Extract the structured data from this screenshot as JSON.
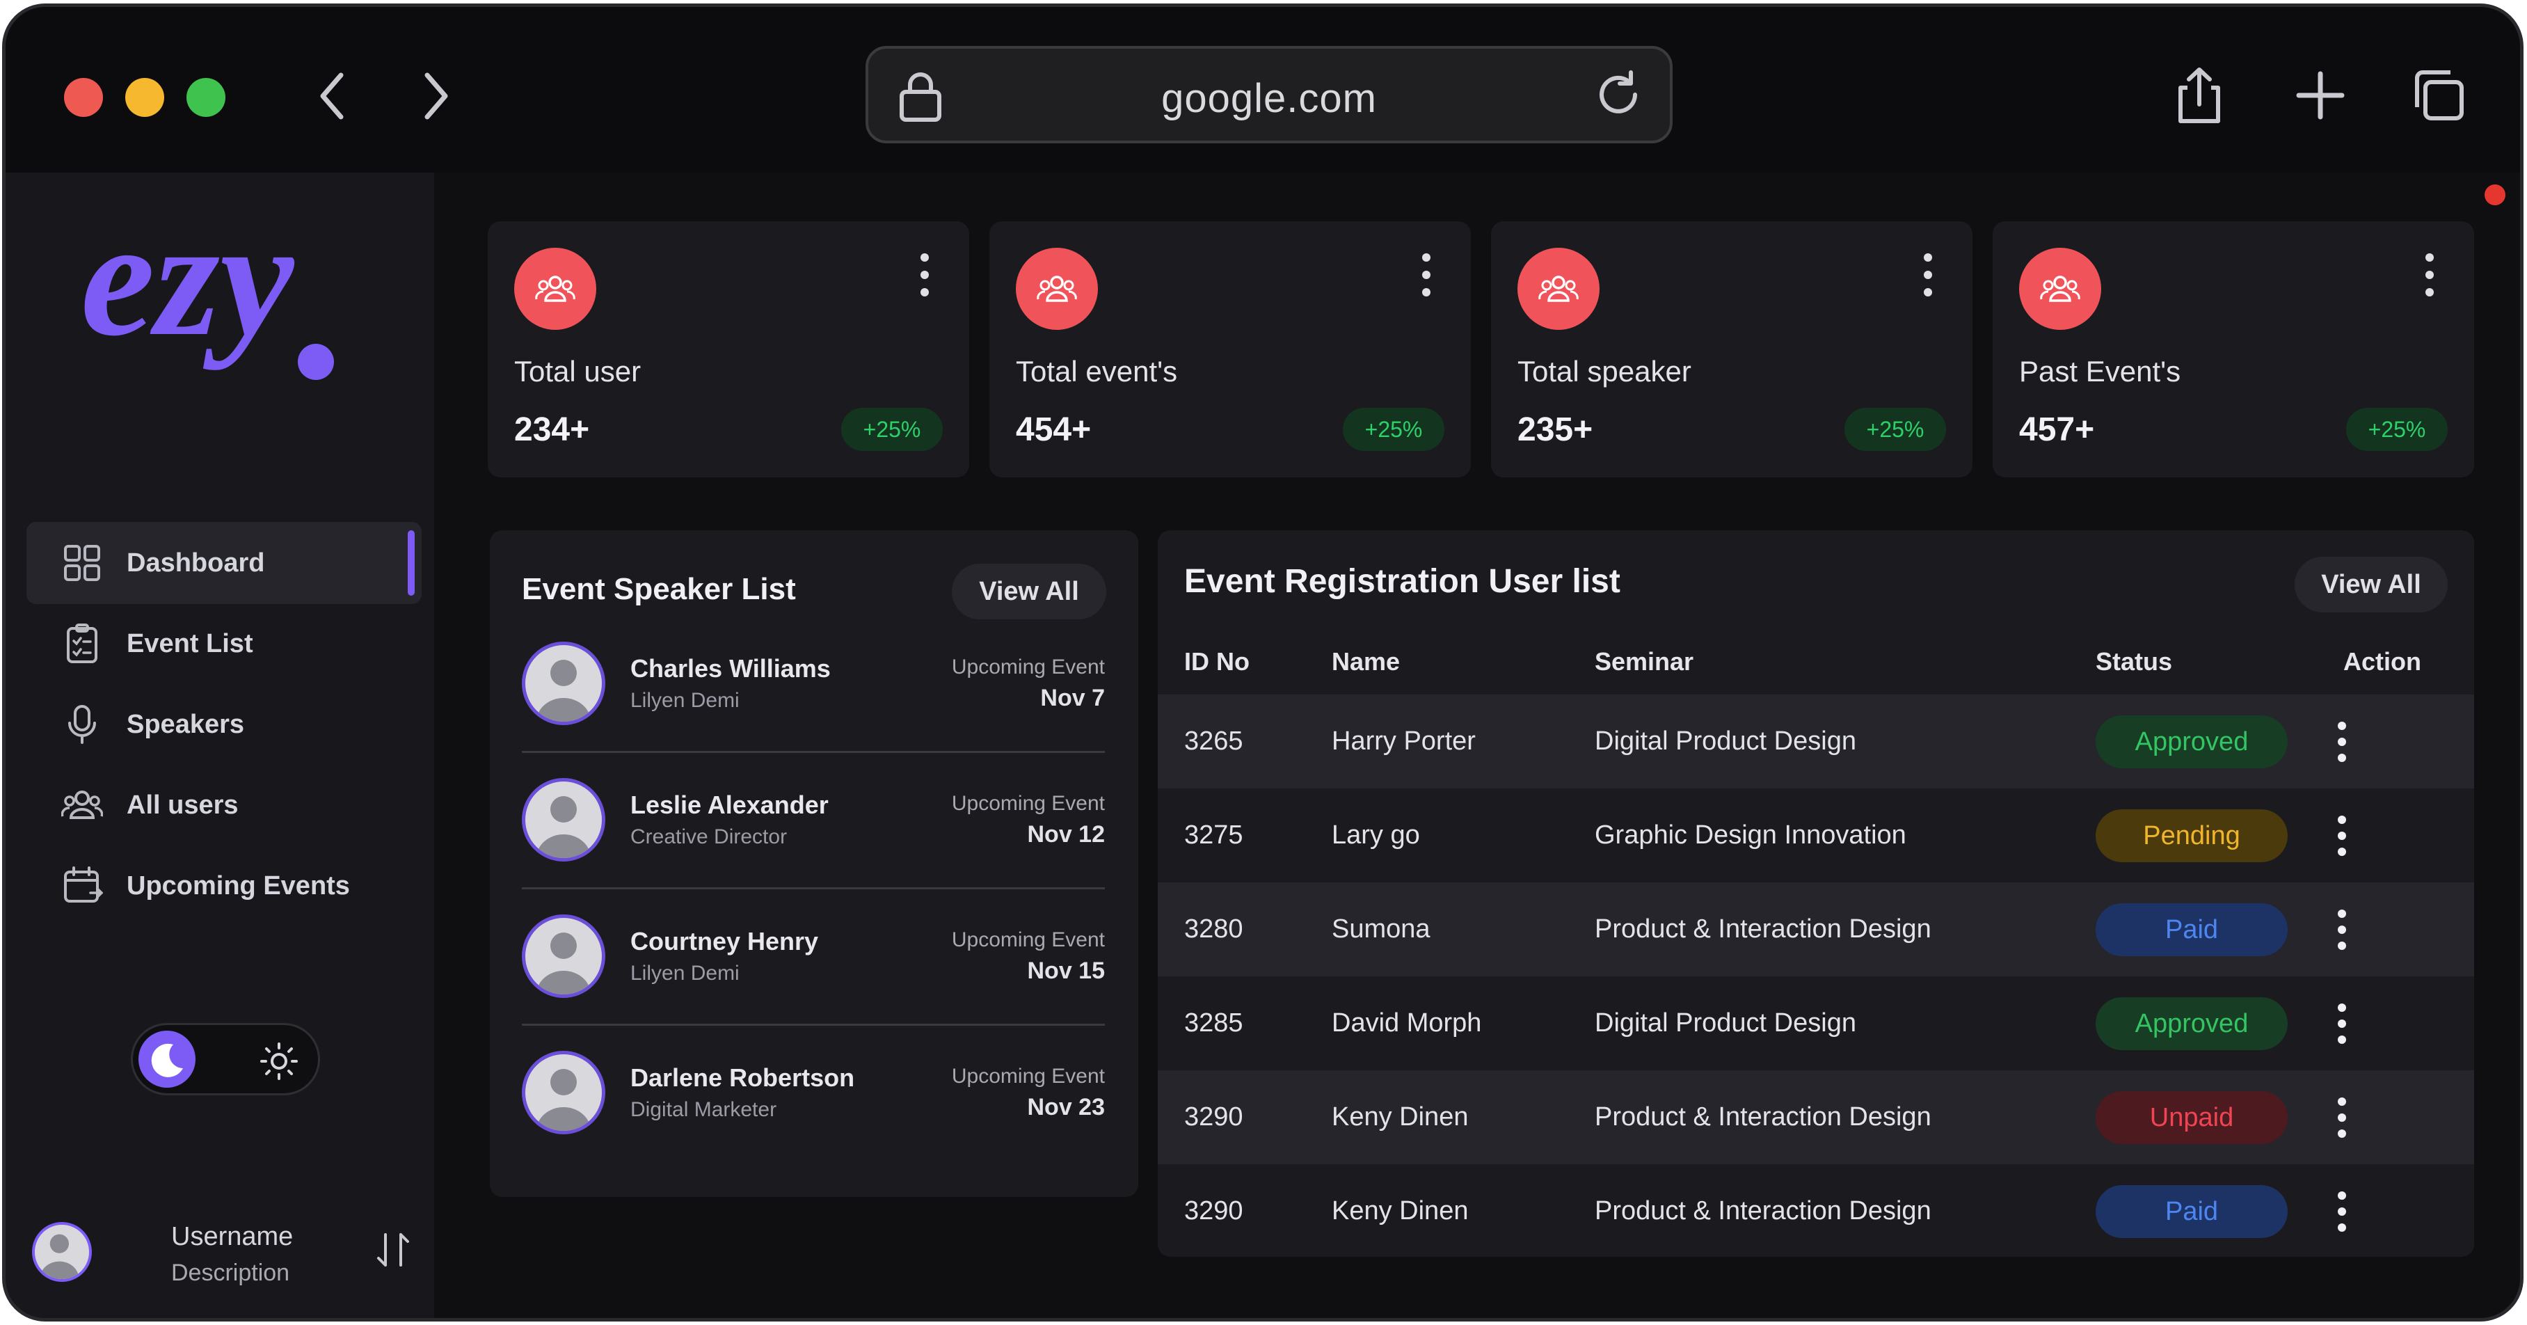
{
  "browser": {
    "url": "google.com",
    "traffic_lights": [
      "#ee5a52",
      "#f5b82e",
      "#3fc24e"
    ]
  },
  "sidebar": {
    "logo_text": "ezy",
    "nav": [
      {
        "label": "Dashboard",
        "icon": "grid-icon",
        "active": true
      },
      {
        "label": "Event List",
        "icon": "checklist-icon",
        "active": false
      },
      {
        "label": "Speakers",
        "icon": "microphone-icon",
        "active": false
      },
      {
        "label": "All users",
        "icon": "users-icon",
        "active": false
      },
      {
        "label": "Upcoming Events",
        "icon": "calendar-icon",
        "active": false
      }
    ],
    "theme_toggle": {
      "selected": "dark"
    },
    "user": {
      "name": "Username",
      "description": "Description"
    }
  },
  "stats": [
    {
      "label": "Total user",
      "value": "234+",
      "change": "+25%"
    },
    {
      "label": "Total event's",
      "value": "454+",
      "change": "+25%"
    },
    {
      "label": "Total speaker",
      "value": "235+",
      "change": "+25%"
    },
    {
      "label": "Past Event's",
      "value": "457+",
      "change": "+25%"
    }
  ],
  "speakers": {
    "title": "Event Speaker List",
    "view_all": "View All",
    "items": [
      {
        "name": "Charles Williams",
        "role": "Lilyen Demi",
        "event": "Upcoming Event",
        "date": "Nov 7"
      },
      {
        "name": "Leslie Alexander",
        "role": "Creative Director",
        "event": "Upcoming Event",
        "date": "Nov 12"
      },
      {
        "name": "Courtney Henry",
        "role": "Lilyen Demi",
        "event": "Upcoming Event",
        "date": "Nov 15"
      },
      {
        "name": "Darlene Robertson",
        "role": "Digital Marketer",
        "event": "Upcoming Event",
        "date": "Nov 23"
      }
    ]
  },
  "registrations": {
    "title": "Event Registration User list",
    "view_all": "View All",
    "columns": [
      "ID No",
      "Name",
      "Seminar",
      "Status",
      "Action"
    ],
    "rows": [
      {
        "id": "3265",
        "name": "Harry Porter",
        "seminar": "Digital Product Design",
        "status": "Approved"
      },
      {
        "id": "3275",
        "name": "Lary go",
        "seminar": "Graphic Design Innovation",
        "status": "Pending"
      },
      {
        "id": "3280",
        "name": "Sumona",
        "seminar": "Product & Interaction Design",
        "status": "Paid"
      },
      {
        "id": "3285",
        "name": "David Morph",
        "seminar": "Digital Product Design",
        "status": "Approved"
      },
      {
        "id": "3290",
        "name": "Keny Dinen",
        "seminar": "Product & Interaction Design",
        "status": "Unpaid"
      },
      {
        "id": "3290",
        "name": "Keny Dinen",
        "seminar": "Product & Interaction Design",
        "status": "Paid"
      }
    ],
    "status_colors": {
      "Approved": {
        "bg": "#173d25",
        "fg": "#34c463"
      },
      "Pending": {
        "bg": "#4a3a0c",
        "fg": "#f0b52a"
      },
      "Paid": {
        "bg": "#1d3366",
        "fg": "#4d86f0"
      },
      "Unpaid": {
        "bg": "#4d1a1f",
        "fg": "#ee4454"
      }
    }
  },
  "accent_color": "#7c5cf5"
}
